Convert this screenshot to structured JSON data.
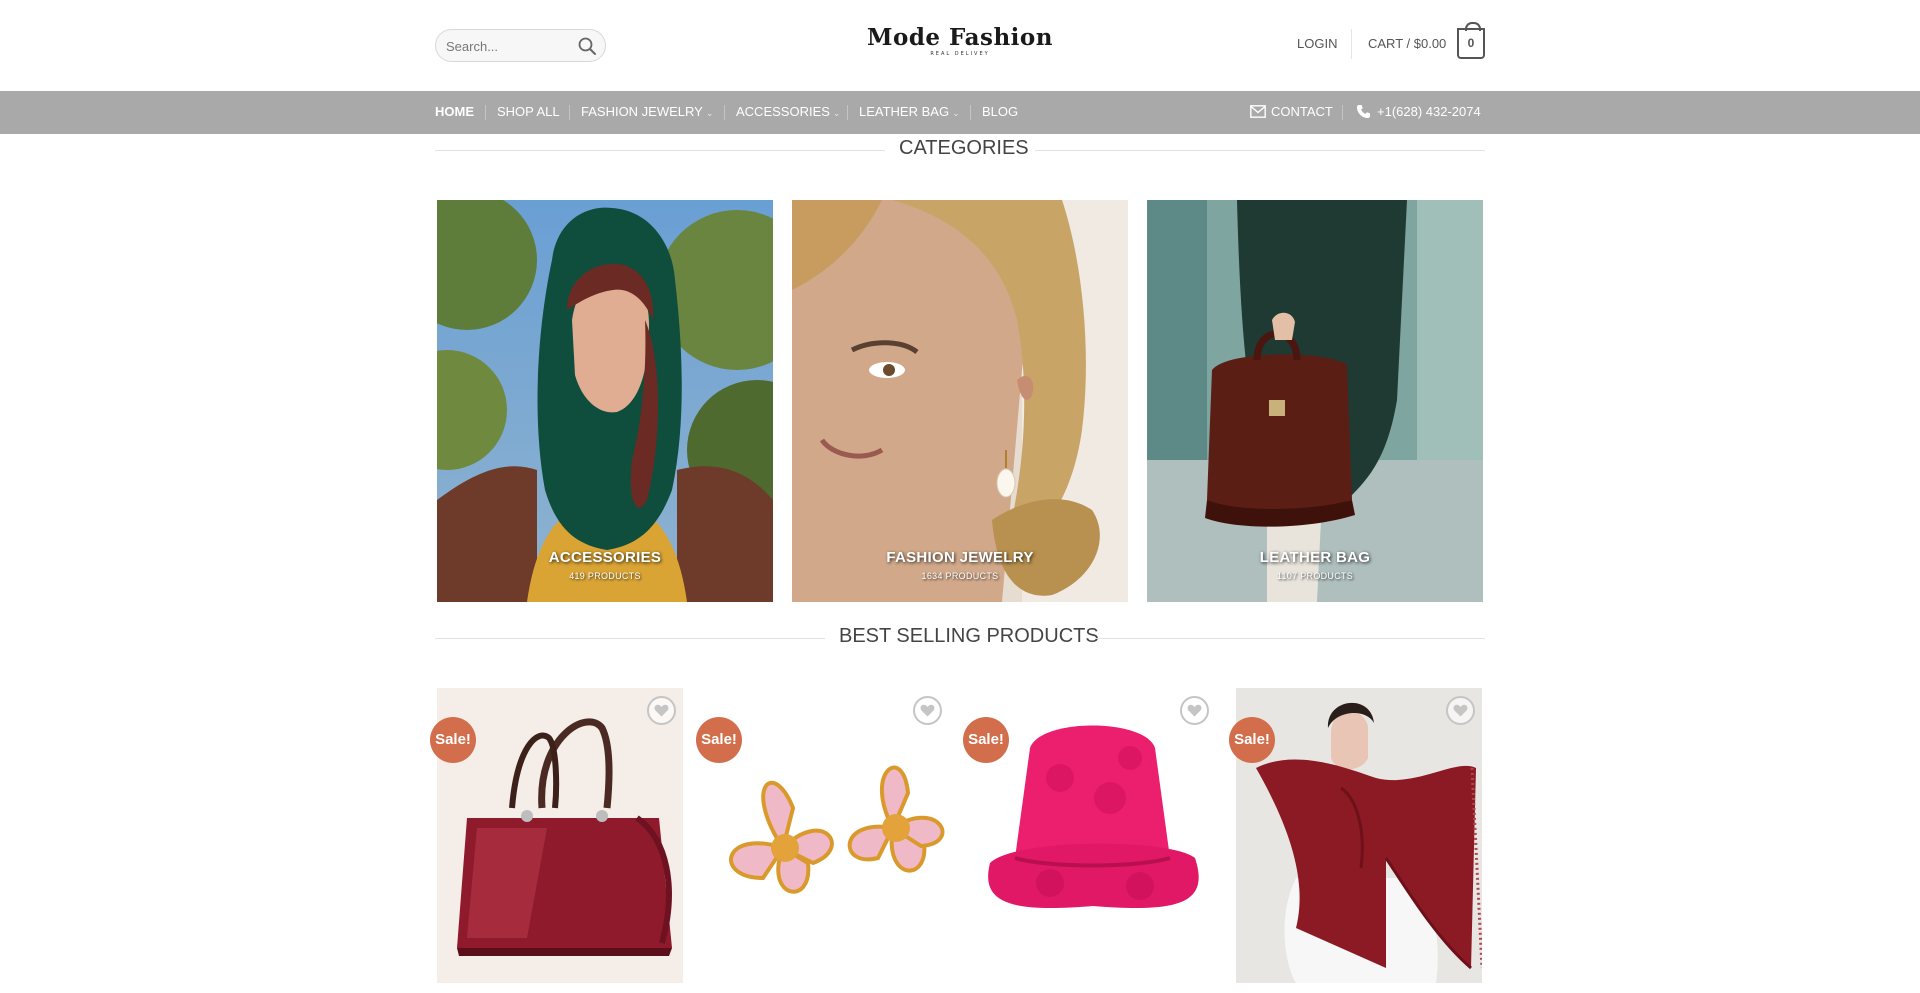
{
  "header": {
    "search_placeholder": "Search...",
    "logo_name": "Mode Fashion",
    "logo_tagline": "REAL DELIVEY",
    "login_label": "LOGIN",
    "cart_label": "CART / $0.00",
    "cart_count": "0"
  },
  "nav": {
    "items": [
      {
        "label": "HOME"
      },
      {
        "label": "SHOP ALL"
      },
      {
        "label": "FASHION JEWELRY",
        "chevron": "chevron-down-icon"
      },
      {
        "label": "ACCESSORIES",
        "chevron": "chevron-down-icon"
      },
      {
        "label": "LEATHER BAG",
        "chevron": "chevron-down-icon"
      },
      {
        "label": "BLOG"
      }
    ],
    "contact_label": "CONTACT",
    "phone_label": "+1(628) 432-2074"
  },
  "categories": {
    "title": "CATEGORIES",
    "items": [
      {
        "label": "ACCESSORIES",
        "count": "419 PRODUCTS"
      },
      {
        "label": "FASHION JEWELRY",
        "count": "1634 PRODUCTS"
      },
      {
        "label": "LEATHER BAG",
        "count": "1107 PRODUCTS"
      }
    ]
  },
  "best_selling": {
    "title": "BEST SELLING PRODUCTS",
    "sale_badge": "Sale!",
    "products": [
      {
        "image": "burgundy patent leather handbag"
      },
      {
        "image": "pink flower enamel earrings"
      },
      {
        "image": "pink bucket hat"
      },
      {
        "image": "woman in burgundy scarf"
      }
    ]
  },
  "colors": {
    "nav_bg": "#a9a9a9",
    "sale_badge": "#d26e4b",
    "text": "#555555"
  }
}
